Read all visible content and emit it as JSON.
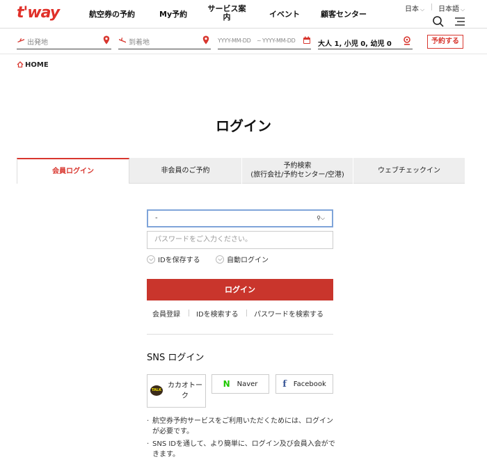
{
  "header": {
    "logo": "t'way",
    "nav": [
      "航空券の予約",
      "My予約",
      "サービス案\n内",
      "イベント",
      "顧客センター"
    ],
    "country": "日本",
    "language": "日本語"
  },
  "booking": {
    "from_placeholder": "出発地",
    "to_placeholder": "到着地",
    "date_start": "YYYY-MM-DD",
    "date_sep": "~",
    "date_end": "YYYY-MM-DD",
    "passengers": "大人 1, 小児 0, 幼児 0",
    "reserve_label": "予約する"
  },
  "breadcrumb": {
    "home": "HOME"
  },
  "page_title": "ログイン",
  "tabs": [
    {
      "label": "会員ログイン",
      "active": true
    },
    {
      "label": "非会員のご予約",
      "active": false
    },
    {
      "label": "予約検索\n(旅行会社/予約センター/空港)",
      "active": false
    },
    {
      "label": "ウェブチェックイン",
      "active": false
    }
  ],
  "form": {
    "id_select_value": "-",
    "password_placeholder": "パスワードをご入力ください。",
    "save_id_label": "IDを保存する",
    "auto_login_label": "自動ログイン",
    "login_label": "ログイン",
    "links": [
      "会員登録",
      "IDを検索する",
      "パスワードを検索する"
    ]
  },
  "sns": {
    "title": "SNS ログイン",
    "kakao": "カカオトーク",
    "kakao_badge": "TALK",
    "naver": "Naver",
    "facebook": "Facebook"
  },
  "notes": [
    "航空券予約サービスをご利用いただくためには、ログインが必要です。",
    "SNS IDを通して、より簡単に、ログイン及び会員入会ができます。"
  ],
  "colors": {
    "brand": "#d8362e",
    "button": "#c9352c",
    "focus": "#7fa4d9"
  }
}
